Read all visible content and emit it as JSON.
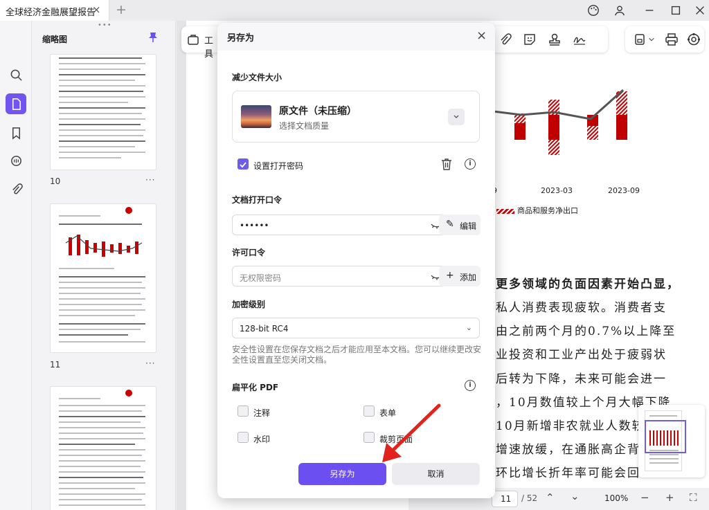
{
  "tab": {
    "title": "全球经济金融展望报告",
    "close": "×",
    "new": "+"
  },
  "sidebar": {
    "title": "缩略图",
    "dots": "•••"
  },
  "thumbnails": [
    {
      "label": "10",
      "more": "···"
    },
    {
      "label": "11",
      "more": "···"
    }
  ],
  "toolbar": {
    "tools_label": "工具"
  },
  "chart_data": {
    "type": "bar",
    "categories": [
      "…9",
      "2023-03",
      "2023-09"
    ],
    "x_tick_labels": [
      "9",
      "2023-03",
      "2023-09"
    ],
    "legend": "商品和服务净出口"
  },
  "document": {
    "lines": [
      "更多领域的负面因素开始凸显，",
      "私人消费表现疲软。消费者支",
      "由之前两个月的0.7%以上降至",
      "业投资和工业产出处于疲弱状",
      "后转为下降，未来可能会进一",
      "，10月数值较上个月大幅下降",
      "10月新增非农就业人数较",
      "增速放缓，在通胀高企背景",
      "环比增长折年率可能会回"
    ]
  },
  "pager": {
    "current": "11",
    "total": "/ 52",
    "zoom": "100%"
  },
  "dialog": {
    "title": "另存为",
    "close": "×",
    "reduce_size": {
      "heading": "减少文件大小",
      "file_name": "原文件（未压缩）",
      "file_sub": "选择文档质量"
    },
    "set_open_password": {
      "label": "设置打开密码",
      "checked": true
    },
    "open_password": {
      "heading": "文档打开口令",
      "value": "••••••",
      "button": "编辑"
    },
    "permission_password": {
      "heading": "许可口令",
      "placeholder": "无权限密码",
      "button": "添加"
    },
    "encryption": {
      "heading": "加密级别",
      "value": "128-bit RC4",
      "note": "安全性设置在您保存文档之后才能应用至本文档。您可以继续更改安全性设置直至您关闭文档。"
    },
    "flatten": {
      "heading": "扁平化 PDF",
      "options": [
        "注释",
        "表单",
        "水印",
        "裁剪页面"
      ]
    },
    "save_button": "另存为",
    "cancel_button": "取消"
  },
  "colors": {
    "accent": "#6c4ff0",
    "chart_red": "#c00000"
  }
}
